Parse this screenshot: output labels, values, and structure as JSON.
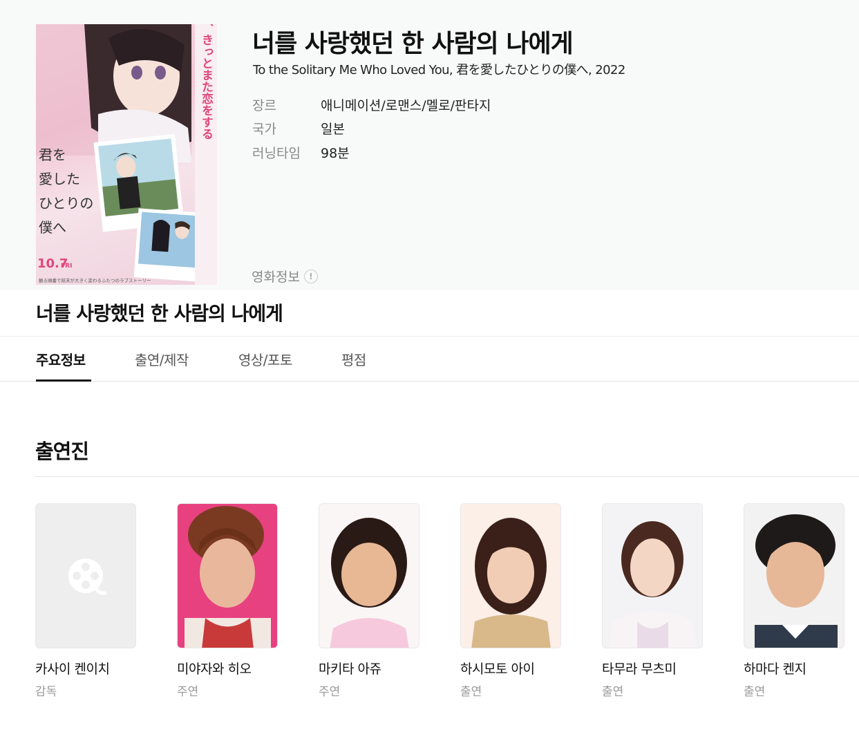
{
  "movie": {
    "title": "너를 사랑했던 한 사람의 나에게",
    "subtitle": "To the Solitary Me Who Loved You, 君を愛したひとりの僕へ, 2022",
    "poster_text": {
      "vertical_tagline": "どの世界の君にも、きっとまた恋をする",
      "title_lines": [
        "君を",
        "愛した",
        "ひとりの",
        "僕へ"
      ],
      "date": "10.7",
      "day": "FRI",
      "bottom_line": "観る順番で結末が大きく変わるふたつのラブストーリー"
    },
    "info": [
      {
        "label": "장르",
        "value": "애니메이션/로맨스/멜로/판타지"
      },
      {
        "label": "국가",
        "value": "일본"
      },
      {
        "label": "러닝타임",
        "value": "98분"
      }
    ],
    "movie_info_label": "영화정보",
    "info_icon_glyph": "!"
  },
  "section_title": "너를 사랑했던 한 사람의 나에게",
  "tabs": [
    {
      "label": "주요정보",
      "active": true
    },
    {
      "label": "출연/제작",
      "active": false
    },
    {
      "label": "영상/포토",
      "active": false
    },
    {
      "label": "평점",
      "active": false
    }
  ],
  "cast": {
    "title": "출연진",
    "members": [
      {
        "name": "카사이 켄이치",
        "role": "감독",
        "photo": "placeholder-film-icon"
      },
      {
        "name": "미야자와 히오",
        "role": "주연",
        "photo": "portrait"
      },
      {
        "name": "마키타 아쥬",
        "role": "주연",
        "photo": "portrait"
      },
      {
        "name": "하시모토 아이",
        "role": "출연",
        "photo": "portrait"
      },
      {
        "name": "타무라 무츠미",
        "role": "출연",
        "photo": "portrait"
      },
      {
        "name": "하마다 켄지",
        "role": "출연",
        "photo": "portrait"
      }
    ]
  },
  "colors": {
    "hero_bg": "#f8f9f9",
    "label_gray": "#888888",
    "accent_pink": "#e0487a",
    "text_dark": "#111111"
  }
}
